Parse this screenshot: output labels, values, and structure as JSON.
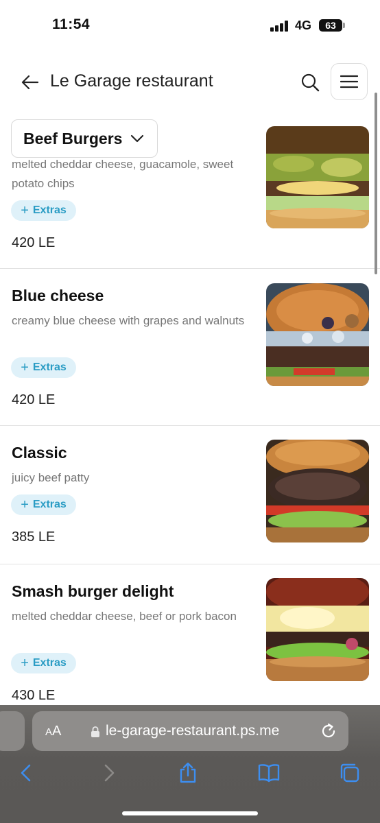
{
  "status": {
    "time": "11:54",
    "network": "4G",
    "battery": "63"
  },
  "header": {
    "title": "Le Garage restaurant"
  },
  "category": {
    "label": "Beef Burgers"
  },
  "items": [
    {
      "name": "",
      "description": "melted cheddar cheese, guacamole, sweet potato chips",
      "extras": "Extras",
      "price": "420 LE",
      "image": "guacamole-burger-photo"
    },
    {
      "name": "Blue cheese",
      "description": "creamy blue cheese with grapes and walnuts",
      "extras": "Extras",
      "price": "420 LE",
      "image": "blue-cheese-burger-photo"
    },
    {
      "name": "Classic",
      "description": "juicy beef patty",
      "extras": "Extras",
      "price": "385 LE",
      "image": "classic-burger-photo"
    },
    {
      "name": "Smash burger delight",
      "description": "melted cheddar cheese, beef or pork bacon",
      "extras": "Extras",
      "price": "430 LE",
      "image": "smash-burger-photo"
    }
  ],
  "browser": {
    "aa_label": "AA",
    "url": "le-garage-restaurant.ps.me"
  },
  "colors": {
    "accent": "#2a9cc4",
    "extras_bg": "#dff1f9",
    "safari_bar": "#5b5957"
  }
}
